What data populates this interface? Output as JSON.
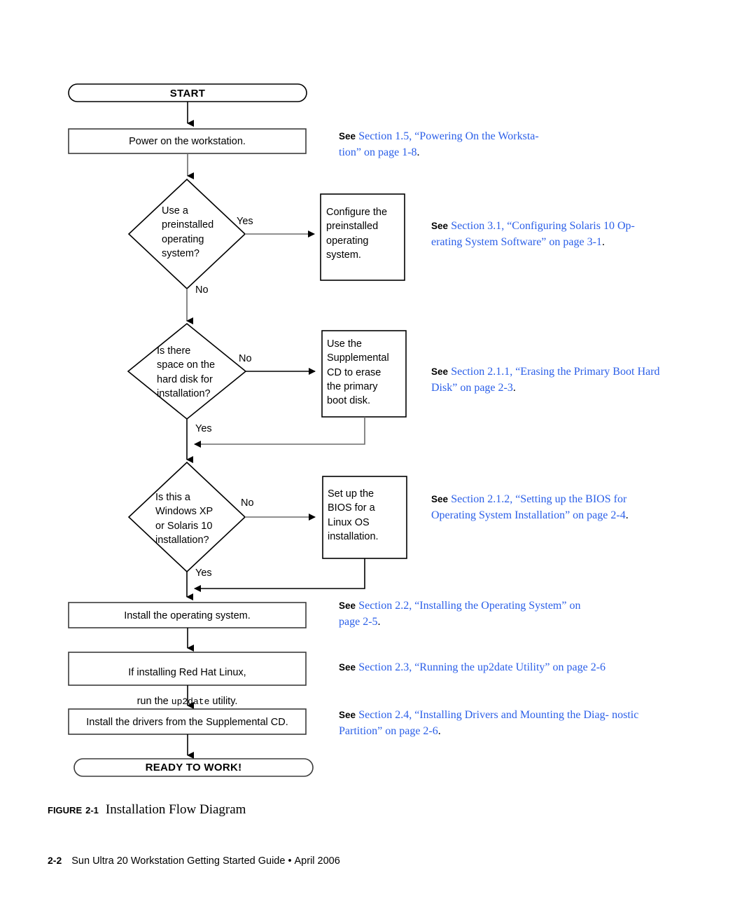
{
  "document": {
    "figure_label": "FIGURE",
    "figure_number": "2-1",
    "figure_title": "Installation Flow Diagram",
    "footer_page": "2-2",
    "footer_text": "Sun Ultra 20 Workstation Getting Started Guide",
    "footer_separator": "•",
    "footer_date": "April 2006",
    "link_color": "#2b5fe8"
  },
  "flowchart": {
    "start_terminal": "START",
    "end_terminal": "READY TO WORK!",
    "step_power_on": "Power on the workstation.",
    "decision_preinstalled": "Use a\npreinstalled\noperating\nsystem?",
    "decision_preinstalled_yes": "Yes",
    "decision_preinstalled_no": "No",
    "action_configure_preinstalled": "Configure the\npreinstalled\noperating\nsystem.",
    "decision_space": "Is there\nspace on the\nhard disk for\ninstallation?",
    "decision_space_no": "No",
    "decision_space_yes": "Yes",
    "action_erase_disk": "Use the\nSupplemental\nCD to erase\nthe primary\nboot disk.",
    "decision_os_type": "Is this a\nWindows XP\nor Solaris 10\ninstallation?",
    "decision_os_type_no": "No",
    "decision_os_type_yes": "Yes",
    "action_setup_bios": "Set up the\nBIOS for a\nLinux OS\ninstallation.",
    "step_install_os": "Install the operating system.",
    "step_up2date_line1": "If installing Red Hat Linux,",
    "step_up2date_line2_pre": "run the ",
    "step_up2date_command": "up2date",
    "step_up2date_line2_post": " utility.",
    "step_install_drivers": "Install the drivers from the Supplemental CD."
  },
  "references": {
    "see_label": "See",
    "ref1": {
      "line1": "Section 1.5, “Powering On the Worksta-",
      "line2": "tion” on page 1-8",
      "period": "."
    },
    "ref2": {
      "line1": "Section 3.1, “Configuring Solaris 10 Op-",
      "line2": "erating System Software” on page 3-1",
      "period": "."
    },
    "ref3": {
      "line1": "Section 2.1.1, “Erasing the Primary Boot",
      "line2": "Hard Disk” on page 2-3",
      "period": "."
    },
    "ref4": {
      "line1": "Section 2.1.2, “Setting up the BIOS for",
      "line2": "Operating System Installation” on page 2-4",
      "period": "."
    },
    "ref5": {
      "line1": "Section 2.2, “Installing the Operating System” on",
      "line2": "page 2-5",
      "period": "."
    },
    "ref6": {
      "line1": "Section 2.3, “Running the up2date Utility” on page 2-6",
      "line2": "",
      "period": ""
    },
    "ref7": {
      "line1": "Section 2.4, “Installing Drivers and Mounting the Diag-",
      "line2": "nostic Partition” on page 2-6",
      "period": "."
    }
  }
}
